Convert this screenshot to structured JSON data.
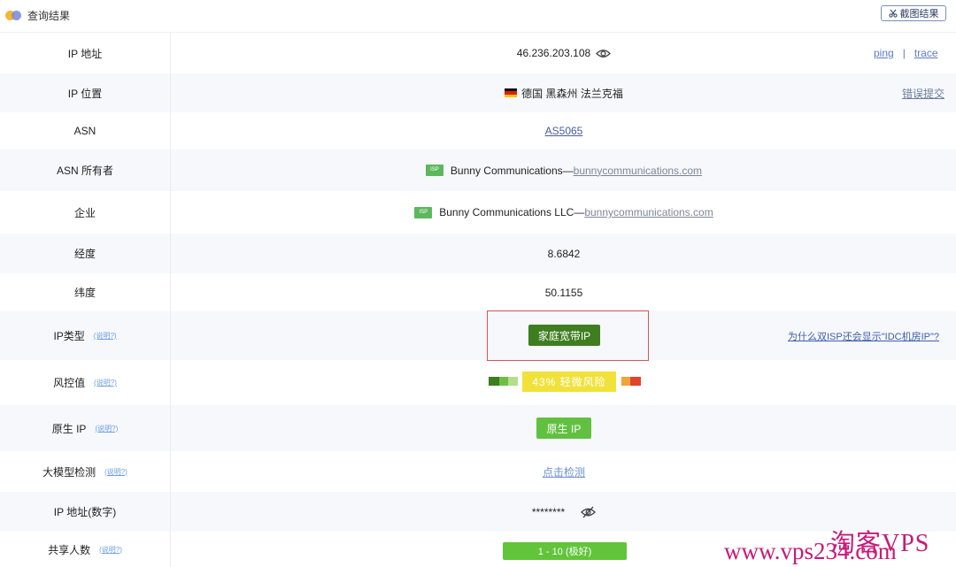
{
  "header": {
    "title": "查询结果",
    "screenshot_label": "截图结果"
  },
  "rows": {
    "ip": {
      "label": "IP 地址",
      "value": "46.236.203.108",
      "ping": "ping",
      "separator": "|",
      "trace": "trace"
    },
    "location": {
      "label": "IP 位置",
      "value": "德国 黑森州 法兰克福",
      "report": "错误提交"
    },
    "asn": {
      "label": "ASN",
      "value": "AS5065"
    },
    "asn_owner": {
      "label": "ASN 所有者",
      "badge": "ISP",
      "name": "Bunny Communications—",
      "domain": "bunnycommunications.com"
    },
    "company": {
      "label": "企业",
      "badge": "ISP",
      "name": "Bunny Communications LLC—",
      "domain": "bunnycommunications.com"
    },
    "longitude": {
      "label": "经度",
      "value": "8.6842"
    },
    "latitude": {
      "label": "纬度",
      "value": "50.1155"
    },
    "ip_type": {
      "label": "IP类型",
      "help": "(说明?)",
      "value": "家庭宽带IP",
      "why": "为什么双ISP还会显示\"IDC机房IP\"?"
    },
    "risk": {
      "label": "风控值",
      "help": "(说明?)",
      "value": "43%  轻微风险",
      "percent": 43
    },
    "native": {
      "label": "原生 IP",
      "help": "(说明?)",
      "value": "原生 IP"
    },
    "llm": {
      "label": "大模型检测",
      "help": "(说明?)",
      "value": "点击检测"
    },
    "ip_numeric": {
      "label": "IP 地址(数字)",
      "value": "********"
    },
    "shared": {
      "label": "共享人数",
      "help": "(说明?)",
      "value": "1 - 10 (极好)"
    }
  },
  "watermark": {
    "line1": "淘客VPS",
    "line2": "www.vps234.com"
  },
  "colors": {
    "accent_link": "#485c98",
    "ip_type_bg": "#3f7d21",
    "risk_pill_bg": "#f0e23a",
    "native_bg": "#62c040",
    "highlight_border": "#d45555"
  }
}
